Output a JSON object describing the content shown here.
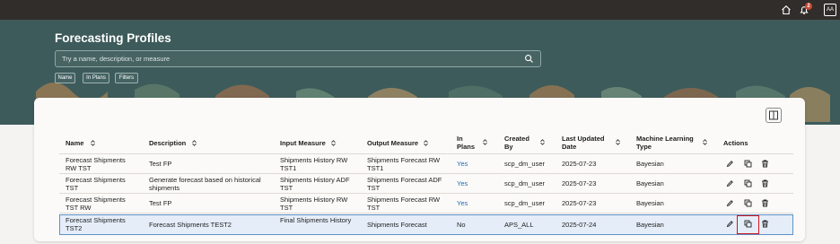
{
  "topbar": {
    "home_icon": "home-icon",
    "bell_icon": "bell-icon",
    "notification_count": "2",
    "user_initials": "AA"
  },
  "page": {
    "title": "Forecasting Profiles",
    "search_placeholder": "Try a name, description, or measure",
    "filter_chips": [
      "Name",
      "In Plans",
      "Filters"
    ]
  },
  "table": {
    "columns": [
      "Name",
      "Description",
      "Input Measure",
      "Output Measure",
      "In Plans",
      "Created By",
      "Last Updated Date",
      "Machine Learning Type",
      "Actions"
    ],
    "rows": [
      {
        "name": "Forecast Shipments RW TST",
        "description": "Test FP",
        "input_measure": "Shipments History RW TST1",
        "output_measure": "Shipments Forecast RW TST1",
        "in_plans": "Yes",
        "created_by": "scp_dm_user",
        "last_updated": "2025-07-23",
        "ml_type": "Bayesian"
      },
      {
        "name": "Forecast Shipments TST",
        "description": "Generate forecast based on historical shipments",
        "input_measure": "Shipments History ADF TST",
        "output_measure": "Shipments Forecast ADF TST",
        "in_plans": "Yes",
        "created_by": "scp_dm_user",
        "last_updated": "2025-07-23",
        "ml_type": "Bayesian"
      },
      {
        "name": "Forecast Shipments TST RW",
        "description": "Test FP",
        "input_measure": "Shipments History RW TST",
        "output_measure": "Shipments Forecast RW TST",
        "in_plans": "Yes",
        "created_by": "scp_dm_user",
        "last_updated": "2025-07-23",
        "ml_type": "Bayesian"
      },
      {
        "name": "Forecast Shipments TST2",
        "description": "Forecast Shipments TEST2",
        "input_measure": "Final Shipments History",
        "output_measure": "Shipments Forecast",
        "in_plans": "No",
        "created_by": "APS_ALL",
        "last_updated": "2025-07-24",
        "ml_type": "Bayesian",
        "selected": true
      }
    ],
    "action_icons": [
      "edit-icon",
      "duplicate-icon",
      "delete-icon"
    ]
  },
  "colors": {
    "topbar": "#312d2a",
    "hero": "#3c5b5a",
    "link": "#1f6db2",
    "selected_row": "#e5eef8",
    "highlight": "#d0161c"
  }
}
